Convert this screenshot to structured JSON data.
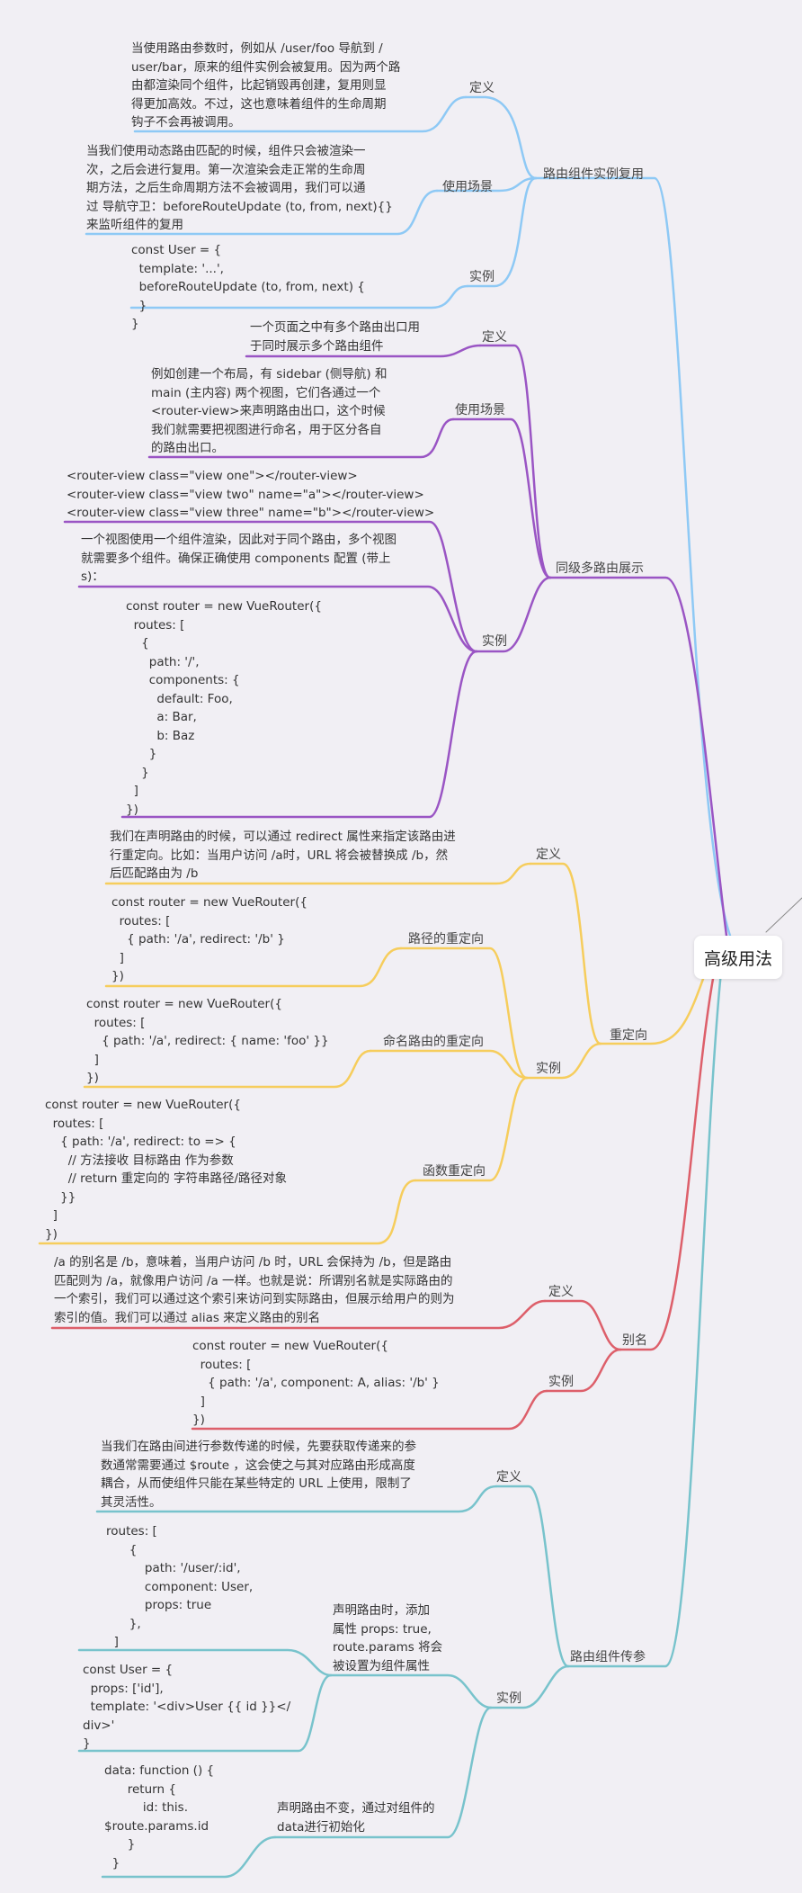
{
  "root": "高级用法",
  "colors": {
    "blue": "#8ec9f5",
    "purple": "#9a55c4",
    "yellow": "#f6cd5c",
    "red": "#dd5f6a",
    "teal": "#78c3cc"
  },
  "branches": {
    "reuse": {
      "title": "路由组件实例复用",
      "def_label": "定义",
      "def_text": "当使用路由参数时，例如从 /user/foo 导航到 /\nuser/bar，原来的组件实例会被复用。因为两个路\n由都渲染同个组件，比起销毁再创建，复用则显\n得更加高效。不过，这也意味着组件的生命周期\n钩子不会再被调用。",
      "use_label": "使用场景",
      "use_text": "当我们使用动态路由匹配的时候，组件只会被渲染一\n次，之后会进行复用。第一次渲染会走正常的生命周\n期方法，之后生命周期方法不会被调用，我们可以通\n过 导航守卫：beforeRouteUpdate (to, from, next){}\n来监听组件的复用",
      "ex_label": "实例",
      "ex_code": "const User = {\n  template: '...',\n  beforeRouteUpdate (to, from, next) {\n  }\n}"
    },
    "multi": {
      "title": "同级多路由展示",
      "def_label": "定义",
      "def_text": "一个页面之中有多个路由出口用\n于同时展示多个路由组件",
      "use_label": "使用场景",
      "use_text": "例如创建一个布局，有 sidebar (侧导航) 和\nmain (主内容) 两个视图，它们各通过一个\n<router-view>来声明路由出口，这个时候\n我们就需要把视图进行命名，用于区分各自\n的路由出口。",
      "ex_label": "实例",
      "ex_code1": "<router-view class=\"view one\"></router-view>\n<router-view class=\"view two\" name=\"a\"></router-view>\n<router-view class=\"view three\" name=\"b\"></router-view>",
      "ex_text2": "一个视图使用一个组件渲染，因此对于同个路由，多个视图\n就需要多个组件。确保正确使用 components 配置 (带上\ns)：",
      "ex_code3": "const router = new VueRouter({\n  routes: [\n    {\n      path: '/',\n      components: {\n        default: Foo,\n        a: Bar,\n        b: Baz\n      }\n    }\n  ]\n})"
    },
    "redirect": {
      "title": "重定向",
      "def_label": "定义",
      "def_text": "我们在声明路由的时候，可以通过 redirect 属性来指定该路由进\n行重定向。比如：当用户访问 /a时，URL 将会被替换成 /b，然\n后匹配路由为 /b",
      "ex_label": "实例",
      "path_label": "路径的重定向",
      "path_code": "const router = new VueRouter({\n  routes: [\n    { path: '/a', redirect: '/b' }\n  ]\n})",
      "named_label": "命名路由的重定向",
      "named_code": "const router = new VueRouter({\n  routes: [\n    { path: '/a', redirect: { name: 'foo' }}\n  ]\n})",
      "fn_label": "函数重定向",
      "fn_code": "const router = new VueRouter({\n  routes: [\n    { path: '/a', redirect: to => {\n      // 方法接收 目标路由 作为参数\n      // return 重定向的 字符串路径/路径对象\n    }}\n  ]\n})"
    },
    "alias": {
      "title": "别名",
      "def_label": "定义",
      "def_text": "/a 的别名是 /b，意味着，当用户访问 /b 时，URL 会保持为 /b，但是路由\n匹配则为 /a，就像用户访问 /a 一样。也就是说：所谓别名就是实际路由的\n一个索引，我们可以通过这个索引来访问到实际路由，但展示给用户的则为\n索引的值。我们可以通过 alias 来定义路由的别名",
      "ex_label": "实例",
      "ex_code": "const router = new VueRouter({\n  routes: [\n    { path: '/a', component: A, alias: '/b' }\n  ]\n})"
    },
    "props": {
      "title": "路由组件传参",
      "def_label": "定义",
      "def_text": "当我们在路由间进行参数传递的时候，先要获取传递来的参\n数通常需要通过 $route ，这会使之与其对应路由形成高度\n耦合，从而使组件只能在某些特定的 URL 上使用，限制了\n其灵活性。",
      "ex_label": "实例",
      "decl_label": "声明路由时，添加\n属性 props: true,\nroute.params 将会\n被设置为组件属性",
      "routes_code": "routes: [\n      {\n          path: '/user/:id',\n          component: User,\n          props: true\n      },\n  ]",
      "user_code": "const User = {\n  props: ['id'],\n  template: '<div>User {{ id }}</\ndiv>'\n}",
      "data_label": "声明路由不变，通过对组件的\ndata进行初始化",
      "data_code": "data: function () {\n      return {\n          id: this.\n$route.params.id\n      }\n  }"
    }
  }
}
